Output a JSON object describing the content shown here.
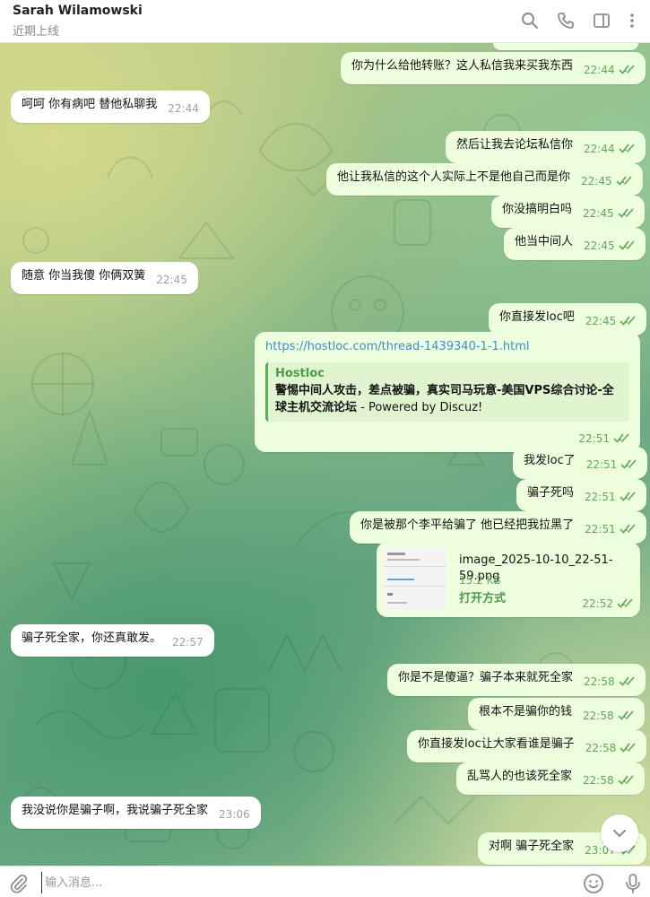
{
  "header": {
    "name": "Sarah Wilamowski",
    "status": "近期上线",
    "icons": [
      "search-icon",
      "phone-icon",
      "sidebar-icon",
      "more-icon"
    ]
  },
  "messages": [
    {
      "id": "m1",
      "dir": "out",
      "text": "你为什么给他转账？这人私信我来买我东西",
      "time": "22:44",
      "read": true
    },
    {
      "id": "m2",
      "dir": "in",
      "text": "呵呵 你有病吧 替他私聊我",
      "time": "22:44"
    },
    {
      "id": "m3",
      "dir": "out",
      "text": "然后让我去论坛私信你",
      "time": "22:44",
      "read": true
    },
    {
      "id": "m4",
      "dir": "out",
      "text": "他让我私信的这个人实际上不是他自己而是你",
      "time": "22:45",
      "read": true
    },
    {
      "id": "m5",
      "dir": "out",
      "text": "你没搞明白吗",
      "time": "22:45",
      "read": true
    },
    {
      "id": "m6",
      "dir": "out",
      "text": "他当中间人",
      "time": "22:45",
      "read": true
    },
    {
      "id": "m7",
      "dir": "in",
      "text": "随意 你当我傻 你俩双簧",
      "time": "22:45"
    },
    {
      "id": "m8",
      "dir": "out",
      "text": "你直接发loc吧",
      "time": "22:45",
      "read": true
    },
    {
      "id": "m9",
      "dir": "out",
      "type": "link",
      "url": "https://hostloc.com/thread-1439340-1-1.html",
      "preview_site": "Hostloc",
      "preview_title_bold": "警惕中间人攻击，差点被骗，真实司马玩意-美国VPS综合讨论-全球主机交流论坛",
      "preview_title_rest": " - Powered by Discuz!",
      "time": "22:51",
      "read": true
    },
    {
      "id": "m10",
      "dir": "out",
      "text": "我发loc了",
      "time": "22:51",
      "read": true
    },
    {
      "id": "m11",
      "dir": "out",
      "text": "骗子死吗",
      "time": "22:51",
      "read": true
    },
    {
      "id": "m12",
      "dir": "out",
      "text": "你是被那个李平给骗了 他已经把我拉黑了",
      "time": "22:51",
      "read": true
    },
    {
      "id": "m13",
      "dir": "out",
      "type": "file",
      "file_name": "image_2025-10-10_22-51-59.png",
      "file_size": "15.2 KB",
      "open_label": "打开方式",
      "time": "22:52",
      "read": true
    },
    {
      "id": "m14",
      "dir": "in",
      "text": "骗子死全家，你还真敢发。",
      "time": "22:57"
    },
    {
      "id": "m15",
      "dir": "out",
      "text": "你是不是傻逼？骗子本来就死全家",
      "time": "22:58",
      "read": true
    },
    {
      "id": "m16",
      "dir": "out",
      "text": "根本不是骗你的钱",
      "time": "22:58",
      "read": true
    },
    {
      "id": "m17",
      "dir": "out",
      "text": "你直接发loc让大家看谁是骗子",
      "time": "22:58",
      "read": true
    },
    {
      "id": "m18",
      "dir": "out",
      "text": "乱骂人的也该死全家",
      "time": "22:58",
      "read": true
    },
    {
      "id": "m19",
      "dir": "in",
      "text": "我没说你是骗子啊，我说骗子死全家",
      "time": "23:06"
    },
    {
      "id": "m20",
      "dir": "out",
      "text": "对啊 骗子死全家",
      "time": "23:07",
      "read": true
    }
  ],
  "composer": {
    "placeholder": "输入消息..."
  },
  "colors": {
    "outgoing_bubble": "#eeffde",
    "incoming_bubble": "#ffffff",
    "accent_green": "#5fa85a"
  }
}
